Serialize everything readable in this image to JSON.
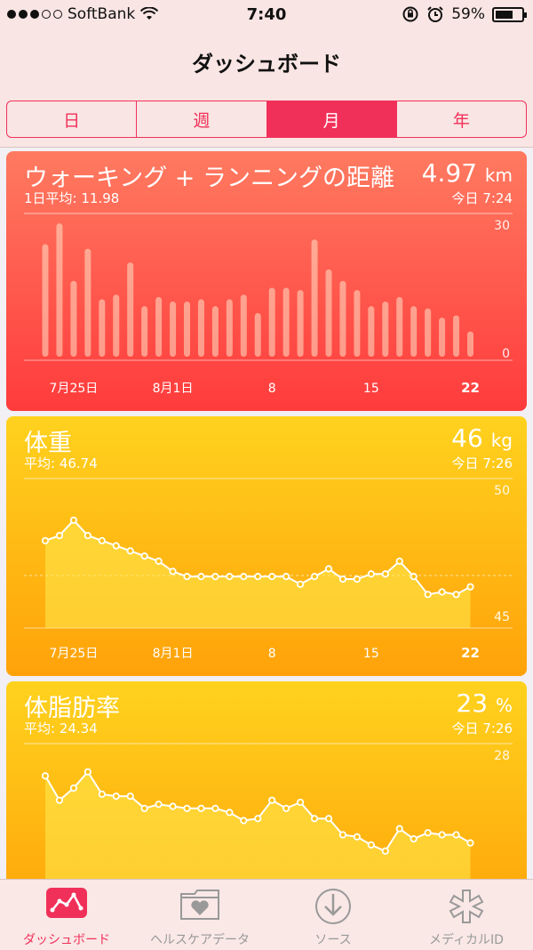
{
  "status": {
    "carrier": "SoftBank",
    "time": "7:40",
    "battery": "59%"
  },
  "nav": {
    "title": "ダッシュボード"
  },
  "segments": [
    {
      "label": "日",
      "active": false
    },
    {
      "label": "週",
      "active": false
    },
    {
      "label": "月",
      "active": true
    },
    {
      "label": "年",
      "active": false
    }
  ],
  "cards": {
    "distance": {
      "title": "ウォーキング + ランニングの距離",
      "value": "4.97",
      "unit": "km",
      "avg": "1日平均: 11.98",
      "when": "今日 7:24"
    },
    "weight": {
      "title": "体重",
      "value": "46",
      "unit": "kg",
      "avg": "平均: 46.74",
      "when": "今日 7:26"
    },
    "bodyfat": {
      "title": "体脂肪率",
      "value": "23",
      "unit": "%",
      "avg": "平均: 24.34",
      "when": "今日 7:26"
    }
  },
  "chart_data": [
    {
      "type": "bar",
      "ylim": [
        0,
        30
      ],
      "yticks": [
        "30",
        "0"
      ],
      "xticks": [
        "7月25日",
        "8月1日",
        "8",
        "15",
        "22"
      ],
      "values": [
        24.5,
        29,
        16.5,
        23.5,
        12.5,
        13.5,
        20.5,
        11,
        13,
        12,
        12,
        12.5,
        11,
        12.5,
        13.5,
        9.5,
        15,
        15,
        14.5,
        25.5,
        19,
        16.5,
        14.5,
        11,
        12,
        13,
        11,
        10.5,
        8.5,
        9,
        5.5
      ]
    },
    {
      "type": "line",
      "ylim": [
        45,
        50
      ],
      "yticks": [
        "50",
        "45"
      ],
      "xticks": [
        "7月25日",
        "8月1日",
        "8",
        "15",
        "22"
      ],
      "values": [
        48.2,
        48.4,
        49,
        48.4,
        48.2,
        48,
        47.8,
        47.6,
        47.4,
        47,
        46.8,
        46.8,
        46.8,
        46.8,
        46.8,
        46.8,
        46.8,
        46.8,
        46.5,
        46.8,
        47.1,
        46.7,
        46.7,
        46.9,
        46.9,
        47.4,
        46.8,
        46.1,
        46.2,
        46.1,
        46.4
      ]
    },
    {
      "type": "line",
      "yticks": [
        "28"
      ],
      "values": [
        27.2,
        26,
        26.6,
        27.4,
        26.3,
        26.2,
        26.2,
        25.6,
        25.8,
        25.7,
        25.6,
        25.6,
        25.6,
        25.4,
        25,
        25.1,
        26,
        25.6,
        25.9,
        25.1,
        25.1,
        24.3,
        24.2,
        23.8,
        23.5,
        24.6,
        24.1,
        24.4,
        24.3,
        24.3,
        23.9
      ]
    }
  ],
  "tabs": [
    {
      "label": "ダッシュボード",
      "icon": "dashboard-icon",
      "active": true
    },
    {
      "label": "ヘルスケアデータ",
      "icon": "health-data-folder-icon",
      "active": false
    },
    {
      "label": "ソース",
      "icon": "sources-download-icon",
      "active": false
    },
    {
      "label": "メディカルID",
      "icon": "medical-id-icon",
      "active": false
    }
  ]
}
